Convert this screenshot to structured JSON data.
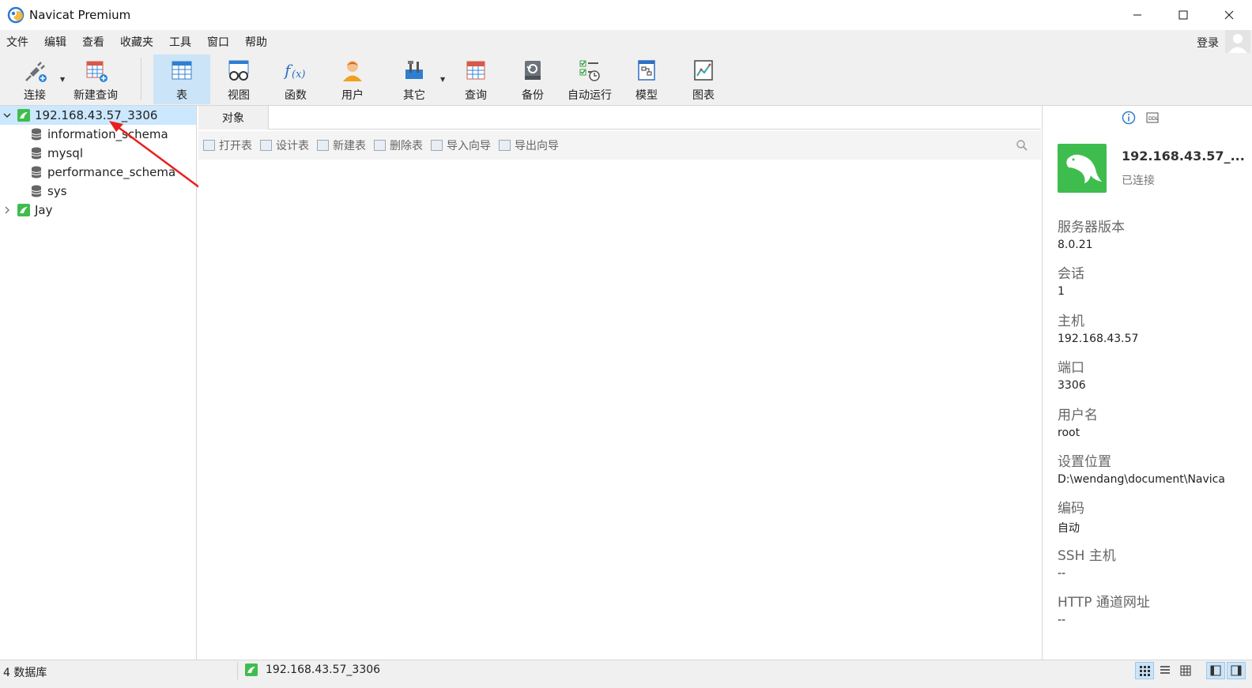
{
  "window": {
    "title": "Navicat Premium"
  },
  "menu": [
    "文件",
    "编辑",
    "查看",
    "收藏夹",
    "工具",
    "窗口",
    "帮助"
  ],
  "account": {
    "login_label": "登录"
  },
  "toolbar": {
    "connect": "连接",
    "new_query": "新建查询",
    "table": "表",
    "view": "视图",
    "function": "函数",
    "user": "用户",
    "other": "其它",
    "query": "查询",
    "backup": "备份",
    "auto_run": "自动运行",
    "model": "模型",
    "chart": "图表"
  },
  "tree": {
    "connection": "192.168.43.57_3306",
    "databases": [
      "information_schema",
      "mysql",
      "performance_schema",
      "sys"
    ],
    "other_connection": "Jay"
  },
  "object_tab": {
    "label": "对象"
  },
  "object_toolbar": [
    "打开表",
    "设计表",
    "新建表",
    "删除表",
    "导入向导",
    "导出向导"
  ],
  "info": {
    "name": "192.168.43.57_...",
    "status": "已连接",
    "fields": [
      {
        "key": "服务器版本",
        "value": "8.0.21"
      },
      {
        "key": "会话",
        "value": "1"
      },
      {
        "key": "主机",
        "value": "192.168.43.57"
      },
      {
        "key": "端口",
        "value": "3306"
      },
      {
        "key": "用户名",
        "value": "root"
      },
      {
        "key": "设置位置",
        "value": "D:\\wendang\\document\\Navica"
      },
      {
        "key": "编码",
        "value": "自动"
      },
      {
        "key": "SSH 主机",
        "value": "--"
      },
      {
        "key": "HTTP 通道网址",
        "value": "--"
      }
    ]
  },
  "statusbar": {
    "db_count": "4 数据库",
    "connection": "192.168.43.57_3306"
  },
  "colors": {
    "accent": "#cce4f7",
    "selection": "#cce8ff",
    "mysql_green": "#3ebd4e",
    "annotation_red": "#e8201c"
  }
}
